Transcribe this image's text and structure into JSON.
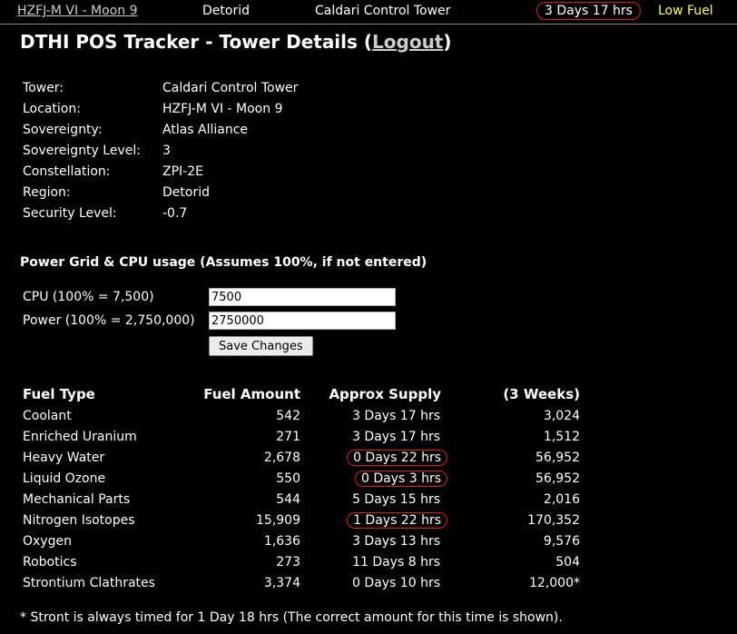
{
  "topbar": {
    "tower_link": "HZFJ-M VI - Moon 9",
    "region": "Detorid",
    "tower_type": "Caldari Control Tower",
    "time_left": "3 Days 17 hrs",
    "status": "Low Fuel",
    "status_color": "#ffff66",
    "highlight_color": "#e01b1b"
  },
  "header": {
    "title": "DTHI POS Tracker - Tower Details (",
    "logout": "Logout",
    "title_end": ")"
  },
  "info": [
    {
      "label": "Tower:",
      "value": "Caldari Control Tower"
    },
    {
      "label": "Location:",
      "value": "HZFJ-M VI - Moon 9"
    },
    {
      "label": "Sovereignty:",
      "value": "Atlas Alliance"
    },
    {
      "label": "Sovereignty Level:",
      "value": "3"
    },
    {
      "label": "Constellation:",
      "value": "ZPI-2E"
    },
    {
      "label": "Region:",
      "value": "Detorid"
    },
    {
      "label": "Security Level:",
      "value": "-0.7"
    }
  ],
  "usage": {
    "title": "Power Grid & CPU usage (Assumes 100%, if not entered)",
    "cpu_label": "CPU (100% = 7,500)",
    "cpu_value": "7500",
    "power_label": "Power (100% = 2,750,000)",
    "power_value": "2750000",
    "save_label": "Save Changes"
  },
  "fuel": {
    "headers": [
      "Fuel Type",
      "Fuel Amount",
      "Approx Supply",
      "(3 Weeks)"
    ],
    "rows": [
      {
        "type": "Coolant",
        "amount": "542",
        "supply": "3 Days 17 hrs",
        "weeks": "3,024",
        "flag": false
      },
      {
        "type": "Enriched Uranium",
        "amount": "271",
        "supply": "3 Days 17 hrs",
        "weeks": "1,512",
        "flag": false
      },
      {
        "type": "Heavy Water",
        "amount": "2,678",
        "supply": "0 Days 22 hrs",
        "weeks": "56,952",
        "flag": true
      },
      {
        "type": "Liquid Ozone",
        "amount": "550",
        "supply": "0 Days 3 hrs",
        "weeks": "56,952",
        "flag": true
      },
      {
        "type": "Mechanical Parts",
        "amount": "544",
        "supply": "5 Days 15 hrs",
        "weeks": "2,016",
        "flag": false
      },
      {
        "type": "Nitrogen Isotopes",
        "amount": "15,909",
        "supply": "1 Days 22 hrs",
        "weeks": "170,352",
        "flag": true
      },
      {
        "type": "Oxygen",
        "amount": "1,636",
        "supply": "3 Days 13 hrs",
        "weeks": "9,576",
        "flag": false
      },
      {
        "type": "Robotics",
        "amount": "273",
        "supply": "11 Days 8 hrs",
        "weeks": "504",
        "flag": false
      },
      {
        "type": "Strontium Clathrates",
        "amount": "3,374",
        "supply": "0 Days 10 hrs",
        "weeks": "12,000*",
        "flag": false
      }
    ]
  },
  "footnote": "* Stront is always timed for 1 Day 18 hrs (The correct amount for this time is shown)."
}
